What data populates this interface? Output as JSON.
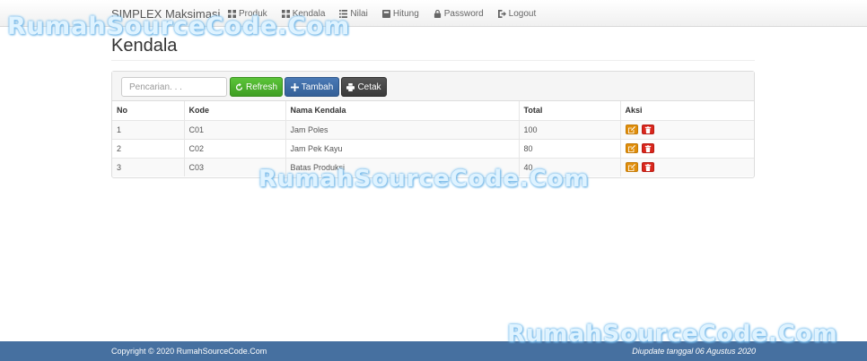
{
  "navbar": {
    "brand": "SIMPLEX Maksimasi",
    "items": [
      {
        "label": "Produk",
        "icon": "grid-icon"
      },
      {
        "label": "Kendala",
        "icon": "grid-icon"
      },
      {
        "label": "Nilai",
        "icon": "list-icon"
      },
      {
        "label": "Hitung",
        "icon": "calculator-icon"
      },
      {
        "label": "Password",
        "icon": "lock-icon"
      },
      {
        "label": "Logout",
        "icon": "logout-icon"
      }
    ]
  },
  "watermark": "RumahSourceCode.Com",
  "page": {
    "title": "Kendala"
  },
  "toolbar": {
    "search_placeholder": "Pencarian. . .",
    "refresh_label": "Refresh",
    "tambah_label": "Tambah",
    "cetak_label": "Cetak"
  },
  "table": {
    "headers": [
      "No",
      "Kode",
      "Nama Kendala",
      "Total",
      "Aksi"
    ],
    "rows": [
      [
        "1",
        "C01",
        "Jam Poles",
        "100"
      ],
      [
        "2",
        "C02",
        "Jam Pek Kayu",
        "80"
      ],
      [
        "3",
        "C03",
        "Batas Produksi",
        "40"
      ]
    ]
  },
  "footer": {
    "copyright": "Copyright © 2020 RumahSourceCode.Com",
    "updated": "Diupdate tanggal 06 Agustus 2020"
  },
  "colors": {
    "footer_bg": "#4670a0",
    "refresh": "#4cae2c",
    "tambah": "#3b6aa6",
    "cetak": "#444444",
    "edit": "#e08e0b",
    "delete": "#d9261c"
  }
}
